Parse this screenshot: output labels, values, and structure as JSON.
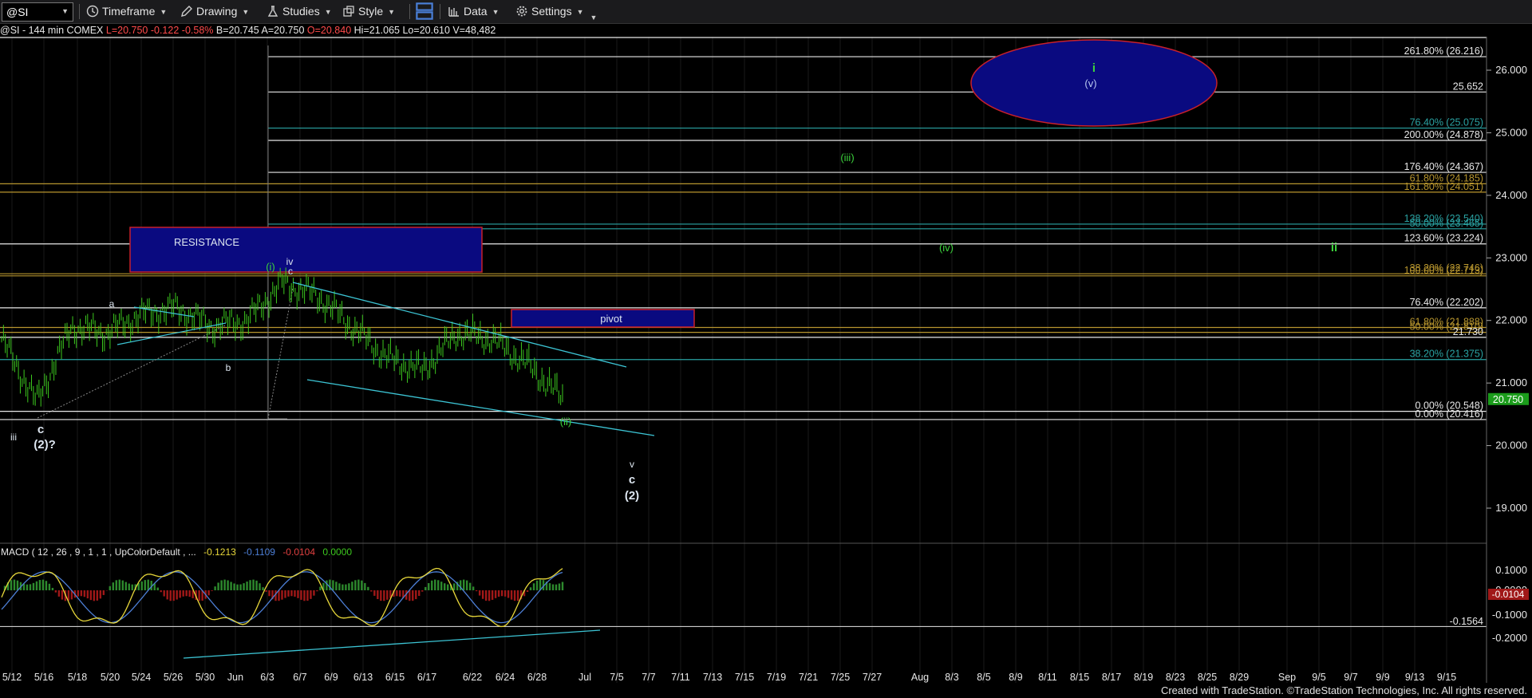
{
  "toolbar": {
    "symbol": "@SI",
    "timeframe": "Timeframe",
    "drawing": "Drawing",
    "studies": "Studies",
    "style": "Style",
    "data": "Data",
    "settings": "Settings"
  },
  "infobar": {
    "title": "@SI - 144 min  COMEX",
    "last": "L=20.750",
    "change": "-0.122",
    "change_pct": "-0.58%",
    "bid": "B=20.745",
    "ask": "A=20.750",
    "open": "O=20.840",
    "high": "Hi=21.065",
    "low": "Lo=20.610",
    "volume": "V=48,482"
  },
  "colors": {
    "background": "#000000",
    "fib_white": "#e8e8e8",
    "fib_teal": "#2aa3a3",
    "fib_gold": "#b7952e",
    "trendline": "#3cc4d4",
    "price_bar": "#3cc81e",
    "label_green": "#3cd23c",
    "label_white": "#dde6f0",
    "box_fill": "#0a0a80",
    "box_border": "#c8202a",
    "macd_line": "#4d7fd6",
    "signal_line": "#e8d83a",
    "hist_up": "#2d8a2d",
    "hist_down": "#a01818",
    "current_price_bg": "#1b9c1b"
  },
  "price_axis": {
    "ticks": [
      "26.000",
      "25.000",
      "24.000",
      "23.000",
      "22.000",
      "21.000",
      "20.000",
      "19.000"
    ],
    "current_price": "20.750"
  },
  "fib_levels": [
    {
      "label": "261.80% (26.216)",
      "price": 26.216,
      "color": "white"
    },
    {
      "label": "25.652",
      "price": 25.652,
      "color": "white"
    },
    {
      "label": "76.40% (25.075)",
      "price": 25.075,
      "color": "teal"
    },
    {
      "label": "200.00% (24.878)",
      "price": 24.878,
      "color": "white"
    },
    {
      "label": "176.40% (24.367)",
      "price": 24.367,
      "color": "white"
    },
    {
      "label": "61.80% (24.185)",
      "price": 24.185,
      "color": "gold"
    },
    {
      "label": "161.80% (24.051)",
      "price": 24.051,
      "color": "gold"
    },
    {
      "label": "138.20% (23.540)",
      "price": 23.54,
      "color": "teal"
    },
    {
      "label": "50.00% (23.465)",
      "price": 23.465,
      "color": "teal"
    },
    {
      "label": "123.60% (23.224)",
      "price": 23.224,
      "color": "white"
    },
    {
      "label": "38.20% (22.746)",
      "price": 22.746,
      "color": "gold"
    },
    {
      "label": "100.00% (22.713)",
      "price": 22.713,
      "color": "gold"
    },
    {
      "label": "76.40% (22.202)",
      "price": 22.202,
      "color": "white"
    },
    {
      "label": "61.80% (21.888)",
      "price": 21.888,
      "color": "gold"
    },
    {
      "label": "50.00% (21.810)",
      "price": 21.81,
      "color": "gold"
    },
    {
      "label": "21.730",
      "price": 21.73,
      "color": "white"
    },
    {
      "label": "38.20% (21.375)",
      "price": 21.375,
      "color": "teal"
    },
    {
      "label": "0.00% (20.548)",
      "price": 20.548,
      "color": "white"
    },
    {
      "label": "0.00% (20.416)",
      "price": 20.416,
      "color": "white"
    }
  ],
  "boxes": {
    "resistance": "RESISTANCE",
    "pivot": "pivot"
  },
  "wave_labels": {
    "i_green": "i",
    "v_paren": "(v)",
    "iii_paren": "(iii)",
    "iv_paren": "(iv)",
    "ii_green": "ii",
    "i_paren": "(i)",
    "iv": "iv",
    "c_small": "c",
    "a": "a",
    "b": "b",
    "ii_paren": "(ii)",
    "iii": "iii",
    "c_big": "c",
    "two_q": "(2)?",
    "v_target": "v",
    "c_target": "c",
    "two_target": "(2)"
  },
  "macd": {
    "label": "MACD ( 12 , 26 , 9 , 1 , 1 , UpColorDefault , ...",
    "macd_val": "-0.1213",
    "signal_val": "-0.1109",
    "hist_val": "-0.0104",
    "zero_val": "0.0000",
    "axis_ticks": [
      "0.1000",
      "0.0000",
      "-0.1000",
      "-0.2000"
    ],
    "hist_marker": "-0.0104",
    "level_line": "-0.1564"
  },
  "x_axis": [
    "5/12",
    "5/16",
    "5/18",
    "5/20",
    "5/24",
    "5/26",
    "5/30",
    "Jun",
    "6/3",
    "6/7",
    "6/9",
    "6/13",
    "6/15",
    "6/17",
    "6/22",
    "6/24",
    "6/28",
    "Jul",
    "7/5",
    "7/7",
    "7/11",
    "7/13",
    "7/15",
    "7/19",
    "7/21",
    "7/25",
    "7/27",
    "Aug",
    "8/3",
    "8/5",
    "8/9",
    "8/11",
    "8/15",
    "8/17",
    "8/19",
    "8/23",
    "8/25",
    "8/29",
    "Sep",
    "9/5",
    "9/7",
    "9/9",
    "9/13",
    "9/15"
  ],
  "chart_data": {
    "type": "line",
    "instrument": "@SI - 144 min  COMEX",
    "y_range": [
      18.5,
      26.5
    ],
    "x": [
      "5/12",
      "5/16",
      "5/18",
      "5/20",
      "5/24",
      "5/26",
      "5/30",
      "Jun",
      "6/3",
      "6/7",
      "6/9",
      "6/13",
      "6/15",
      "6/17",
      "6/22",
      "6/24",
      "6/28"
    ],
    "series": [
      {
        "values": [
          21.7,
          20.7,
          21.9,
          21.8,
          22.1,
          22.2,
          21.9,
          22.0,
          22.6,
          22.4,
          21.9,
          21.4,
          21.2,
          21.8,
          21.7,
          21.3,
          20.75
        ]
      }
    ],
    "fib_levels": [
      26.216,
      25.652,
      25.075,
      24.878,
      24.367,
      24.185,
      24.051,
      23.54,
      23.465,
      23.224,
      22.746,
      22.713,
      22.202,
      21.888,
      21.81,
      21.73,
      21.375,
      20.548,
      20.416
    ],
    "ohlc_last": {
      "open": 20.84,
      "high": 21.065,
      "low": 20.61,
      "last": 20.75,
      "volume": 48482
    }
  },
  "footer": "Created with TradeStation. ©TradeStation Technologies, Inc. All rights reserved."
}
